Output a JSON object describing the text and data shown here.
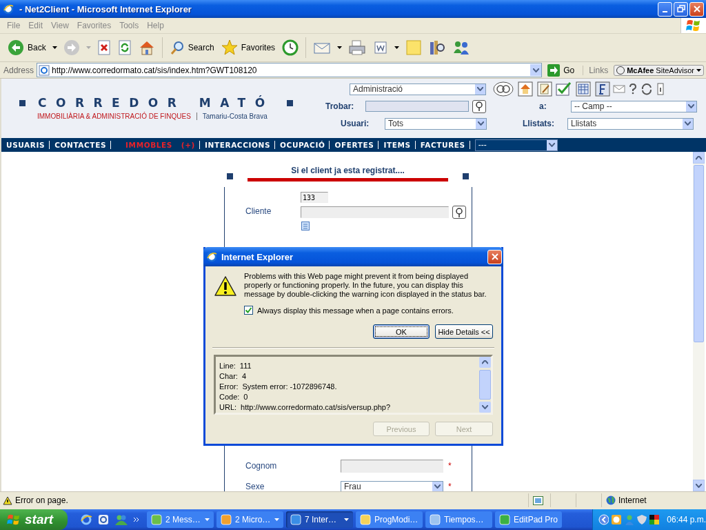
{
  "window": {
    "title": "- Net2Client - Microsoft Internet Explorer"
  },
  "menu": [
    "File",
    "Edit",
    "View",
    "Favorites",
    "Tools",
    "Help"
  ],
  "toolbar": {
    "back": "Back",
    "search": "Search",
    "favorites": "Favorites"
  },
  "address": {
    "label": "Address",
    "url": "http://www.corredormato.cat/sis/index.htm?GWT108120",
    "go": "Go",
    "links": "Links",
    "addon": "**McAfee** SiteAdvisor"
  },
  "site": {
    "logo": "CORREDOR MATÓ",
    "tagline": "IMMOBILIÀRIA & ADMINISTRACIÓ DE FINQUES",
    "location": "Tamariu-Costa Brava",
    "module": "Administració",
    "search_label": "Trobar:",
    "field_label": "a:",
    "field": "-- Camp --",
    "user_label": "Usuari:",
    "user": "Tots",
    "lists_label": "Llistats:",
    "lists": "Llistats"
  },
  "nav": {
    "items": [
      {
        "label": "USUARIS",
        "selected": false
      },
      {
        "label": "CONTACTES",
        "selected": false
      },
      {
        "label": "IMMOBLES",
        "badge": "(+)",
        "selected": true
      },
      {
        "label": "INTERACCIONS",
        "selected": false
      },
      {
        "label": "OCUPACIÓ",
        "selected": false
      },
      {
        "label": "OFERTES",
        "selected": false
      },
      {
        "label": "ITEMS",
        "selected": false
      },
      {
        "label": "FACTURES",
        "selected": false
      }
    ],
    "select": "---"
  },
  "form": {
    "heading": "Si el client ja esta registrat....",
    "client_label": "Cliente",
    "client_code": "133",
    "fields": [
      {
        "kind": "text",
        "label": "Cognom",
        "mark": "*"
      },
      {
        "kind": "select",
        "label": "Sexe",
        "value": "Frau",
        "mark": "*"
      }
    ]
  },
  "dialog": {
    "title": "Internet Explorer",
    "message": "Problems with this Web page might prevent it from being displayed properly or functioning properly. In the future, you can display this message by double-clicking the warning icon displayed in the status bar.",
    "checkbox": {
      "label": "Always display this message when a page contains errors.",
      "checked": true
    },
    "buttons": [
      {
        "label": "OK",
        "default": true
      },
      {
        "label": "Hide Details <<",
        "default": false
      }
    ],
    "details": [
      {
        "key": "Line:",
        "value": "111"
      },
      {
        "key": "Char:",
        "value": "4"
      },
      {
        "key": "Error:",
        "value": "System error: -1072896748."
      },
      {
        "key": "Code:",
        "value": "0"
      },
      {
        "key": "URL:",
        "value": "http://www.corredormato.cat/sis/versup.php?"
      }
    ],
    "nav": [
      {
        "label": "Previous",
        "disabled": true
      },
      {
        "label": "Next",
        "disabled": true
      }
    ]
  },
  "status_bar": {
    "text": "Error on page.",
    "zone": "Internet"
  },
  "taskbar": {
    "start": "start",
    "tasks": [
      {
        "label": "2 Mess…",
        "grouped": true,
        "selected": false
      },
      {
        "label": "2 Micro…",
        "grouped": true,
        "selected": false
      },
      {
        "label": "7 Inter…",
        "grouped": true,
        "selected": true
      },
      {
        "label": "ProgModi…",
        "grouped": false,
        "selected": false
      },
      {
        "label": "Tiempos…",
        "grouped": false,
        "selected": false
      },
      {
        "label": "EditPad Pro",
        "grouped": false,
        "selected": false
      }
    ],
    "clock": "06:44 p.m."
  }
}
